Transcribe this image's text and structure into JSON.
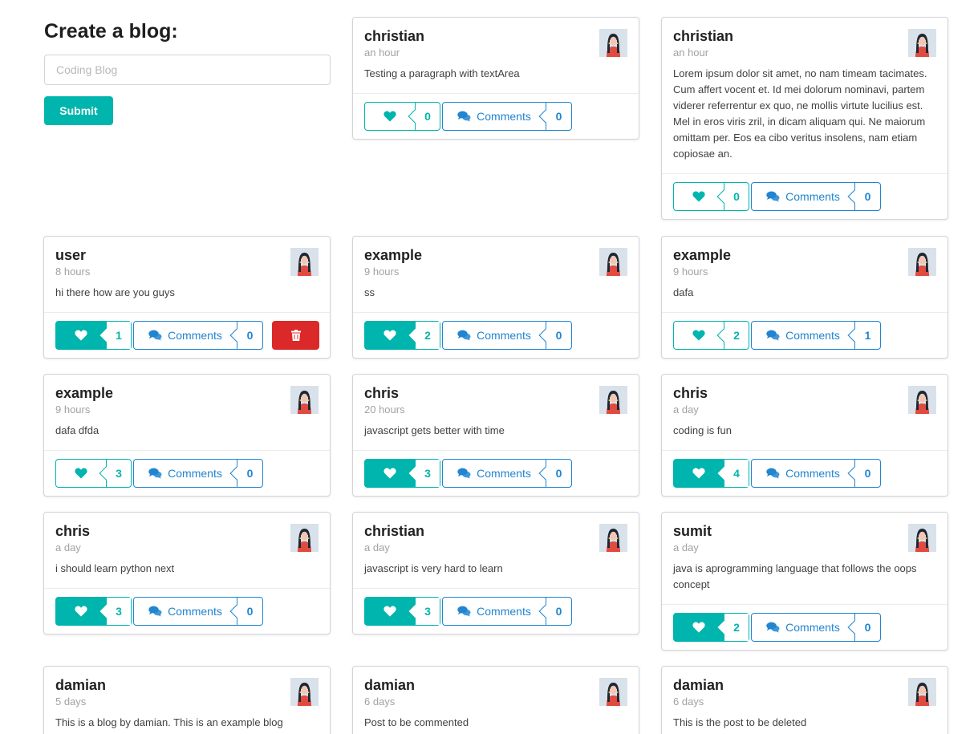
{
  "form": {
    "title": "Create a blog:",
    "input_value": "",
    "input_placeholder": "Coding Blog",
    "submit_label": "Submit"
  },
  "comments_label": "Comments",
  "colors": {
    "teal": "#00b5ad",
    "blue": "#2185d0",
    "red": "#db2828"
  },
  "posts": [
    {
      "user": "christian",
      "time": "an hour",
      "body": "Testing a paragraph with textArea",
      "likes": "0",
      "liked": false,
      "comments": "0",
      "deletable": false
    },
    {
      "user": "christian",
      "time": "an hour",
      "body": "Lorem ipsum dolor sit amet, no nam timeam tacimates. Cum affert vocent et. Id mei dolorum nominavi, partem viderer referrentur ex quo, ne mollis virtute lucilius est. Mel in eros viris zril, in dicam aliquam qui. Ne maiorum omittam per. Eos ea cibo veritus insolens, nam etiam copiosae an.",
      "likes": "0",
      "liked": false,
      "comments": "0",
      "deletable": false
    },
    {
      "user": "user",
      "time": "8 hours",
      "body": "hi there how are you guys",
      "likes": "1",
      "liked": true,
      "comments": "0",
      "deletable": true
    },
    {
      "user": "example",
      "time": "9 hours",
      "body": "ss",
      "likes": "2",
      "liked": true,
      "comments": "0",
      "deletable": false
    },
    {
      "user": "example",
      "time": "9 hours",
      "body": "dafa",
      "likes": "2",
      "liked": false,
      "comments": "1",
      "deletable": false
    },
    {
      "user": "example",
      "time": "9 hours",
      "body": "dafa dfda",
      "likes": "3",
      "liked": false,
      "comments": "0",
      "deletable": false
    },
    {
      "user": "chris",
      "time": "20 hours",
      "body": "javascript gets better with time",
      "likes": "3",
      "liked": true,
      "comments": "0",
      "deletable": false
    },
    {
      "user": "chris",
      "time": "a day",
      "body": "coding is fun",
      "likes": "4",
      "liked": true,
      "comments": "0",
      "deletable": false
    },
    {
      "user": "chris",
      "time": "a day",
      "body": "i should learn python next",
      "likes": "3",
      "liked": true,
      "comments": "0",
      "deletable": false
    },
    {
      "user": "christian",
      "time": "a day",
      "body": "javascript is very hard to learn",
      "likes": "3",
      "liked": true,
      "comments": "0",
      "deletable": false
    },
    {
      "user": "sumit",
      "time": "a day",
      "body": "java is aprogramming language that follows the oops concept",
      "likes": "2",
      "liked": true,
      "comments": "0",
      "deletable": false
    },
    {
      "user": "damian",
      "time": "5 days",
      "body": "This is a blog by damian. This is an example blog",
      "likes": "",
      "liked": false,
      "comments": "",
      "deletable": false
    },
    {
      "user": "damian",
      "time": "6 days",
      "body": "Post to be commented",
      "likes": "",
      "liked": false,
      "comments": "",
      "deletable": false
    },
    {
      "user": "damian",
      "time": "6 days",
      "body": "This is the post to be deleted",
      "likes": "",
      "liked": false,
      "comments": "",
      "deletable": false
    }
  ]
}
